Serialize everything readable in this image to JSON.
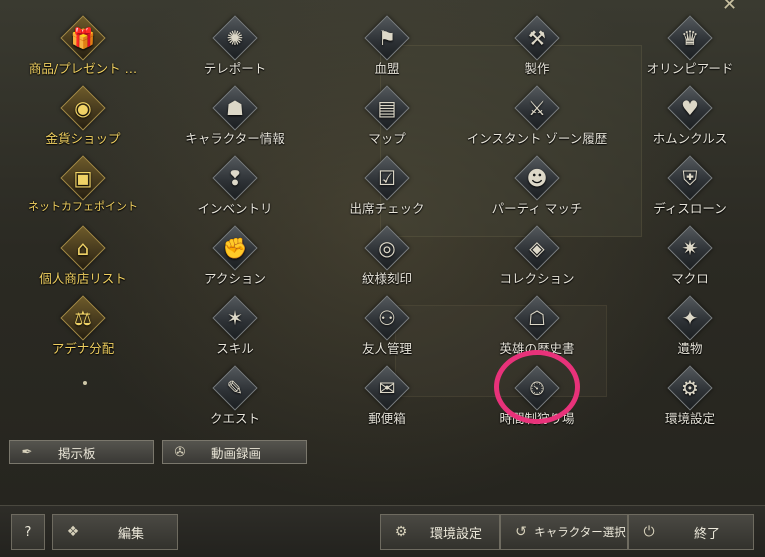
{
  "menu": {
    "items": [
      {
        "label": "商品/プレゼント …",
        "icon": "gift-box-icon",
        "gold": true
      },
      {
        "label": "テレポート",
        "icon": "teleport-swirl-icon",
        "gold": false
      },
      {
        "label": "血盟",
        "icon": "clan-banner-icon",
        "gold": false
      },
      {
        "label": "製作",
        "icon": "hammers-icon",
        "gold": false
      },
      {
        "label": "オリンピアード",
        "icon": "olympiad-icon",
        "gold": false
      },
      {
        "label": "金貨ショップ",
        "icon": "gold-coin-icon",
        "gold": true
      },
      {
        "label": "キャラクター情報",
        "icon": "character-icon",
        "gold": false
      },
      {
        "label": "マップ",
        "icon": "map-icon",
        "gold": false
      },
      {
        "label": "インスタント ゾーン履歴",
        "icon": "crossed-swords-icon",
        "gold": false
      },
      {
        "label": "ホムンクルス",
        "icon": "heart-icon",
        "gold": false
      },
      {
        "label": "ネットカフェポイント",
        "icon": "net-cafe-icon",
        "gold": true
      },
      {
        "label": "インベントリ",
        "icon": "inventory-bag-icon",
        "gold": false
      },
      {
        "label": "出席チェック",
        "icon": "attendance-icon",
        "gold": false
      },
      {
        "label": "パーティ マッチ",
        "icon": "party-icon",
        "gold": false
      },
      {
        "label": "ディスローン",
        "icon": "dethrone-shield-icon",
        "gold": false
      },
      {
        "label": "個人商店リスト",
        "icon": "shop-icon",
        "gold": true
      },
      {
        "label": "アクション",
        "icon": "action-fist-icon",
        "gold": false
      },
      {
        "label": "紋様刻印",
        "icon": "pattern-seal-icon",
        "gold": false
      },
      {
        "label": "コレクション",
        "icon": "collection-icon",
        "gold": false
      },
      {
        "label": "マクロ",
        "icon": "macro-icon",
        "gold": false
      },
      {
        "label": "アデナ分配",
        "icon": "scales-icon",
        "gold": true
      },
      {
        "label": "スキル",
        "icon": "skill-book-icon",
        "gold": false
      },
      {
        "label": "友人管理",
        "icon": "friends-icon",
        "gold": false
      },
      {
        "label": "英雄の歴史書",
        "icon": "hero-book-icon",
        "gold": false
      },
      {
        "label": "遺物",
        "icon": "relic-icon",
        "gold": false
      },
      {
        "label": "クエスト",
        "icon": "quest-scroll-icon",
        "gold": false
      },
      {
        "label": "郵便箱",
        "icon": "mail-icon",
        "gold": false
      },
      {
        "label": "時間制狩り場",
        "icon": "timed-hunting-icon",
        "gold": false
      },
      {
        "label": "環境設定",
        "icon": "settings-icon",
        "gold": false
      }
    ]
  },
  "shortcuts": {
    "board_label": "掲示板",
    "board_icon": "quill-icon",
    "video_label": "動画録画",
    "video_icon": "film-reel-icon"
  },
  "bottom": {
    "help_label": "?",
    "edit_label": "編集",
    "edit_icon": "edit-check-icon",
    "settings_label": "環境設定",
    "settings_icon": "gear-icon",
    "char_select_label": "キャラクター選択",
    "char_select_icon": "return-icon",
    "quit_label": "終了",
    "quit_icon": "power-icon"
  },
  "highlight_color": "#e8327a"
}
